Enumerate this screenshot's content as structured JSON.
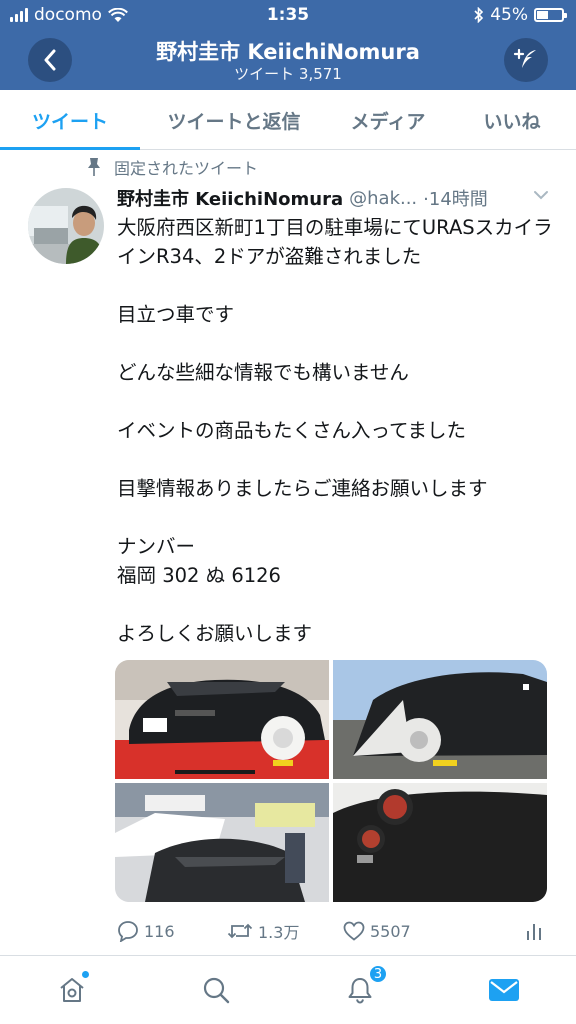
{
  "status_bar": {
    "carrier": "docomo",
    "time": "1:35",
    "battery_percent": "45%",
    "battery_level": 0.45
  },
  "header": {
    "title": "野村圭市 KeiichiNomura",
    "subtitle": "ツイート 3,571",
    "back_icon": "chevron-left-icon",
    "compose_icon": "compose-icon"
  },
  "tabs": [
    {
      "label": "ツイート",
      "active": true
    },
    {
      "label": "ツイートと返信",
      "active": false
    },
    {
      "label": "メディア",
      "active": false
    },
    {
      "label": "いいね",
      "active": false
    }
  ],
  "tweet": {
    "pinned_label": "固定されたツイート",
    "name": "野村圭市 KeiichiNomura",
    "handle": "@hak...",
    "time": "·14時間",
    "body": [
      "大阪府西区新町1丁目の駐車場にてURASスカイラインR34、2ドアが盗難されました",
      "",
      "目立つ車です",
      "",
      "どんな些細な情報でも構いません",
      "",
      "イベントの商品もたくさん入ってました",
      "",
      "目撃情報ありましたらご連絡お願いします",
      "",
      "ナンバー",
      "福岡 302 ぬ 6126",
      "",
      "よろしくお願いします"
    ],
    "actions": {
      "replies": "116",
      "retweets": "1.3万",
      "likes": "5507"
    }
  },
  "bottom_nav": {
    "items": [
      "home-icon",
      "search-icon",
      "notifications-icon",
      "messages-icon"
    ],
    "notification_count": "3"
  },
  "colors": {
    "header_bg": "#3d6aa8",
    "accent": "#1da1f2",
    "muted": "#657786"
  }
}
